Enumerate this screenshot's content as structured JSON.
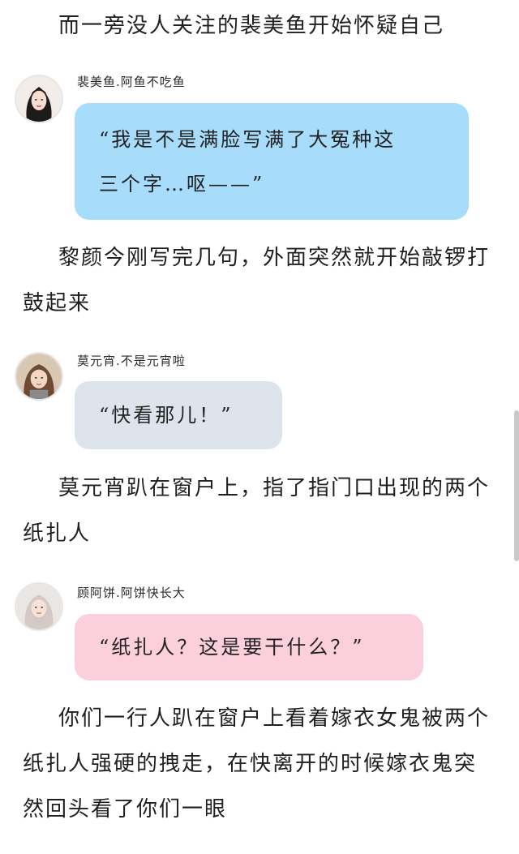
{
  "paragraphs": [
    "而一旁没人关注的裴美鱼开始怀疑自己",
    "黎颜今刚写完几句，外面突然就开始敲锣打鼓起来",
    "莫元宵趴在窗户上，指了指门口出现的两个纸扎人",
    "你们一行人趴在窗户上看着嫁衣女鬼被两个纸扎人强硬的拽走，在快离开的时候嫁衣鬼突然回头看了你们一眼"
  ],
  "messages": [
    {
      "sender": "裴美鱼.阿鱼不吃鱼",
      "avatar_icon": "girl-long-black-hair-avatar-icon",
      "bubble_color": "#a8dcfb",
      "lines": [
        "“我是不是满脸写满了大冤种这",
        "三个字…呕——”"
      ]
    },
    {
      "sender": "莫元宵.不是元宵啦",
      "avatar_icon": "girl-brown-hair-avatar-icon",
      "bubble_color": "#dde4ec",
      "text": "“快看那儿！”"
    },
    {
      "sender": "顾阿饼.阿饼快长大",
      "avatar_icon": "girl-silver-hair-avatar-icon",
      "bubble_color": "#fbcfdc",
      "text": "“纸扎人？这是要干什么？”"
    }
  ]
}
